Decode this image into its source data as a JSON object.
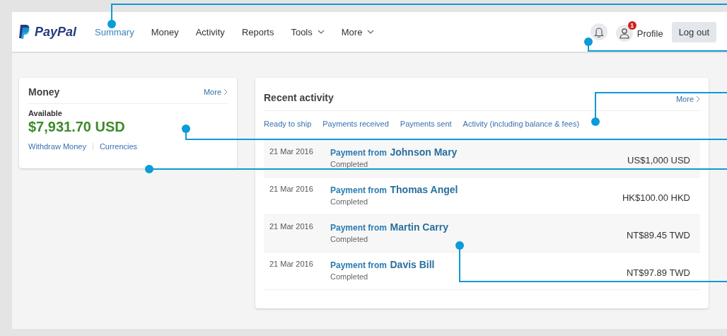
{
  "header": {
    "logo": "PayPal",
    "nav": [
      {
        "label": "Summary",
        "selected": true,
        "dropdown": false
      },
      {
        "label": "Money",
        "selected": false,
        "dropdown": false
      },
      {
        "label": "Activity",
        "selected": false,
        "dropdown": false
      },
      {
        "label": "Reports",
        "selected": false,
        "dropdown": false
      },
      {
        "label": "Tools",
        "selected": false,
        "dropdown": true
      },
      {
        "label": "More",
        "selected": false,
        "dropdown": true
      }
    ],
    "notification_badge": "1",
    "profile": "Profile",
    "logout": "Log out"
  },
  "money_card": {
    "title": "Money",
    "more": "More",
    "available_label": "Available",
    "balance": "$7,931.70 USD",
    "links": [
      "Withdraw Money",
      "Currencies"
    ]
  },
  "activity_card": {
    "title": "Recent activity",
    "more": "More",
    "filters": [
      "Ready to ship",
      "Payments received",
      "Payments sent",
      "Activity (including balance & fees)"
    ],
    "rows": [
      {
        "date": "21 Mar 2016",
        "prefix": "Payment from",
        "name": "Johnson Mary",
        "status": "Completed",
        "amount": "US$1,000 USD"
      },
      {
        "date": "21 Mar 2016",
        "prefix": "Payment from",
        "name": "Thomas Angel",
        "status": "Completed",
        "amount": "HK$100.00 HKD"
      },
      {
        "date": "21 Mar 2016",
        "prefix": "Payment from",
        "name": "Martin Carry",
        "status": "Completed",
        "amount": "NT$89.45 TWD"
      },
      {
        "date": "21 Mar 2016",
        "prefix": "Payment from",
        "name": "Davis Bill",
        "status": "Completed",
        "amount": "NT$97.89 TWD"
      }
    ]
  }
}
